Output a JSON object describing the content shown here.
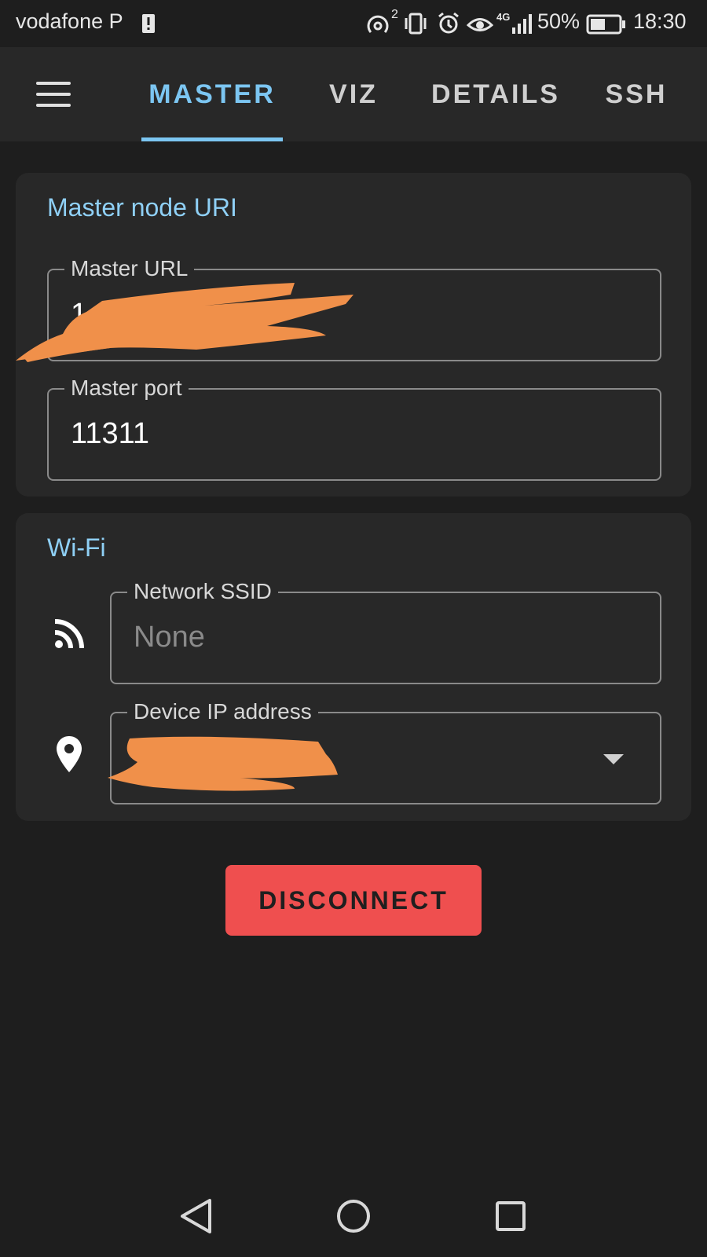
{
  "status_bar": {
    "carrier": "vodafone P",
    "signal_text": "2",
    "network_type": "4G",
    "battery": "50%",
    "time": "18:30"
  },
  "app_bar": {
    "tabs": [
      {
        "label": "MASTER",
        "active": true
      },
      {
        "label": "VIZ",
        "active": false
      },
      {
        "label": "DETAILS",
        "active": false
      },
      {
        "label": "SSH",
        "active": false
      }
    ]
  },
  "master_card": {
    "title": "Master node URI",
    "url_field": {
      "label": "Master URL",
      "value": "1"
    },
    "port_field": {
      "label": "Master port",
      "value": "11311"
    }
  },
  "wifi_card": {
    "title": "Wi-Fi",
    "ssid_field": {
      "label": "Network SSID",
      "value": "None"
    },
    "ip_field": {
      "label": "Device IP address",
      "value": ""
    }
  },
  "actions": {
    "disconnect_label": "DISCONNECT"
  },
  "colors": {
    "accent": "#7cc6f2",
    "danger": "#ef4f4f",
    "background": "#1e1e1e",
    "surface": "#282828",
    "redaction": "#f0904a"
  },
  "icons": {
    "menu": "hamburger-icon",
    "wifi": "wifi-icon",
    "location": "location-pin-icon",
    "dropdown": "chevron-down-icon",
    "nav_back": "triangle-back-icon",
    "nav_home": "circle-home-icon",
    "nav_recents": "square-recents-icon"
  }
}
